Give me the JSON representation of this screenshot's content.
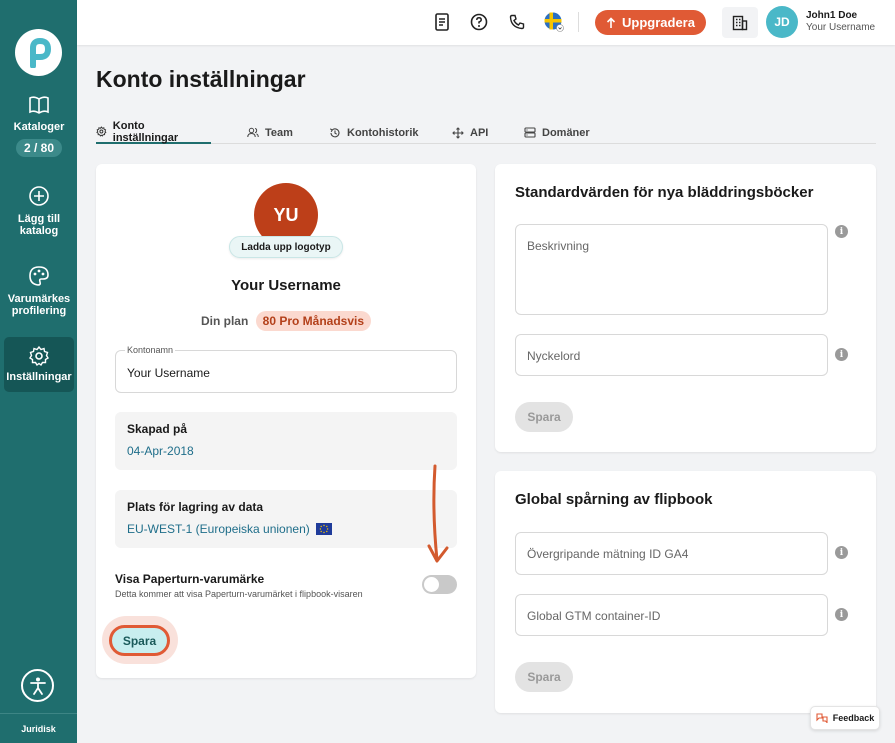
{
  "sidebar": {
    "items": [
      {
        "label": "Kataloger",
        "count": "2 / 80"
      },
      {
        "label": "Lägg till katalog"
      },
      {
        "label": "Varumärkes profilering"
      },
      {
        "label": "Inställningar"
      }
    ],
    "legal": "Juridisk",
    "icons": [
      "logo-p",
      "book-icon",
      "plus-circle-icon",
      "palette-icon",
      "gear-icon",
      "accessibility-icon"
    ]
  },
  "topbar": {
    "upgrade_label": "Uppgradera",
    "avatar_initials": "JD",
    "user_name": "John1 Doe",
    "user_sub": "Your Username",
    "icons": [
      "document-icon",
      "help-icon",
      "phone-icon",
      "sweden-flag-icon",
      "building-icon"
    ]
  },
  "page": {
    "title": "Konto inställningar",
    "tabs": [
      "Konto inställningar",
      "Team",
      "Kontohistorik",
      "API",
      "Domäner"
    ]
  },
  "account": {
    "avatar_initials": "YU",
    "upload_label": "Ladda upp logotyp",
    "username": "Your Username",
    "plan_label": "Din plan",
    "plan_badge": "80 Pro Månadsvis",
    "account_name_label": "Kontonamn",
    "account_name_value": "Your Username",
    "created_label": "Skapad på",
    "created_value": "04-Apr-2018",
    "storage_label": "Plats för lagring av data",
    "storage_value": "EU-WEST-1 (Europeiska unionen)",
    "branding_label": "Visa Paperturn-varumärke",
    "branding_desc": "Detta kommer att visa Paperturn-varumärket i flipbook-visaren",
    "branding_enabled": false,
    "save_label": "Spara"
  },
  "defaults": {
    "title": "Standardvärden för nya bläddringsböcker",
    "description_placeholder": "Beskrivning",
    "keywords_placeholder": "Nyckelord",
    "save_label": "Spara"
  },
  "tracking": {
    "title": "Global spårning av flipbook",
    "ga4_placeholder": "Övergripande mätning ID GA4",
    "gtm_placeholder": "Global GTM container-ID",
    "save_label": "Spara"
  },
  "feedback_label": "Feedback",
  "colors": {
    "primary": "#1f6e6e",
    "accent": "#e05a35",
    "avatar": "#bd3f19",
    "link": "#1f6e8a"
  }
}
